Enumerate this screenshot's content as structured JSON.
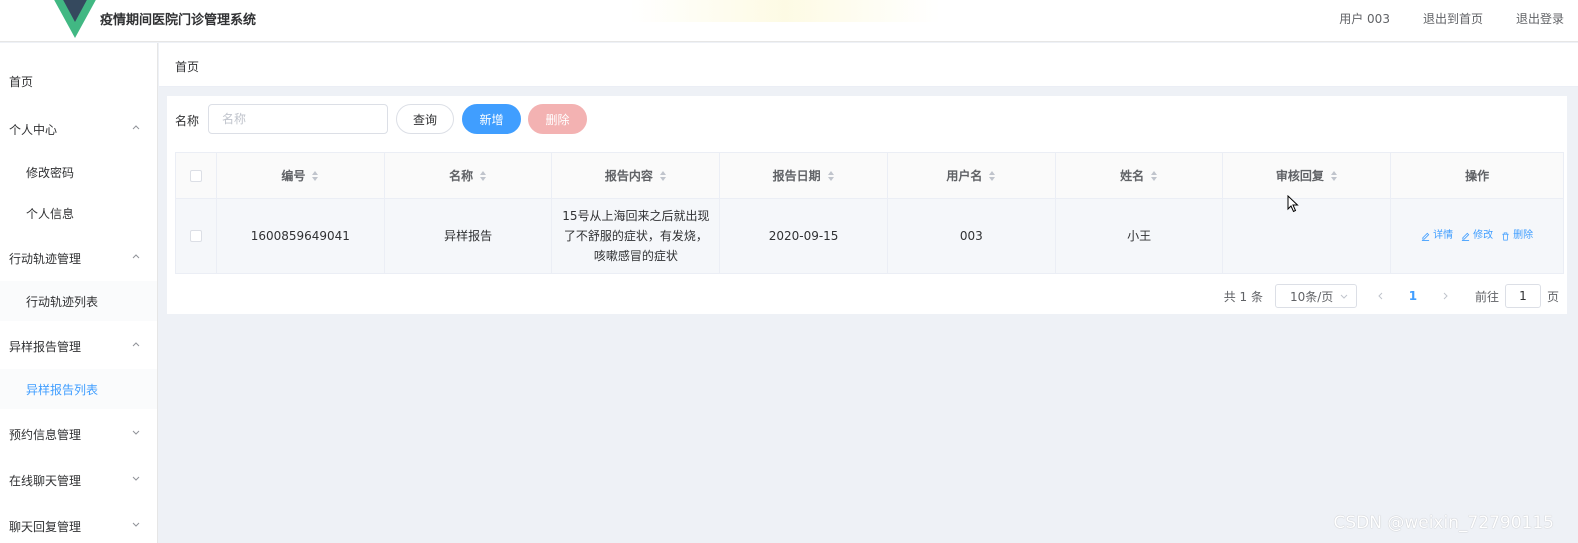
{
  "header": {
    "title": "疫情期间医院门诊管理系统",
    "user": "用户 003",
    "back_home": "退出到首页",
    "logout": "退出登录"
  },
  "sidebar": {
    "items": [
      {
        "label": "首页"
      },
      {
        "label": "个人中心"
      },
      {
        "label": "修改密码"
      },
      {
        "label": "个人信息"
      },
      {
        "label": "行动轨迹管理"
      },
      {
        "label": "行动轨迹列表"
      },
      {
        "label": "异样报告管理"
      },
      {
        "label": "异样报告列表"
      },
      {
        "label": "预约信息管理"
      },
      {
        "label": "在线聊天管理"
      },
      {
        "label": "聊天回复管理"
      }
    ]
  },
  "breadcrumb": {
    "current": "首页"
  },
  "search": {
    "label": "名称",
    "placeholder": "名称",
    "query_label": "查询",
    "add_label": "新增",
    "delete_label": "删除"
  },
  "table": {
    "columns": [
      "编号",
      "名称",
      "报告内容",
      "报告日期",
      "用户名",
      "姓名",
      "审核回复",
      "操作"
    ],
    "rows": [
      {
        "id": "1600859649041",
        "name": "异样报告",
        "content": "15号从上海回来之后就出现了不舒服的症状，有发烧，咳嗽感冒的症状",
        "date": "2020-09-15",
        "username": "003",
        "realname": "小王",
        "reply": "",
        "actions": {
          "detail": "详情",
          "edit": "修改",
          "delete": "删除"
        }
      }
    ]
  },
  "pagination": {
    "total": "共 1 条",
    "page_size": "10条/页",
    "current_page": "1",
    "goto_prefix": "前往",
    "goto_value": "1",
    "goto_suffix": "页"
  },
  "watermark": "CSDN @weixin_72790115",
  "colors": {
    "primary": "#409eff",
    "danger_light": "#f3b2b2",
    "logo_dark": "#35495e",
    "logo_green": "#41b883"
  }
}
